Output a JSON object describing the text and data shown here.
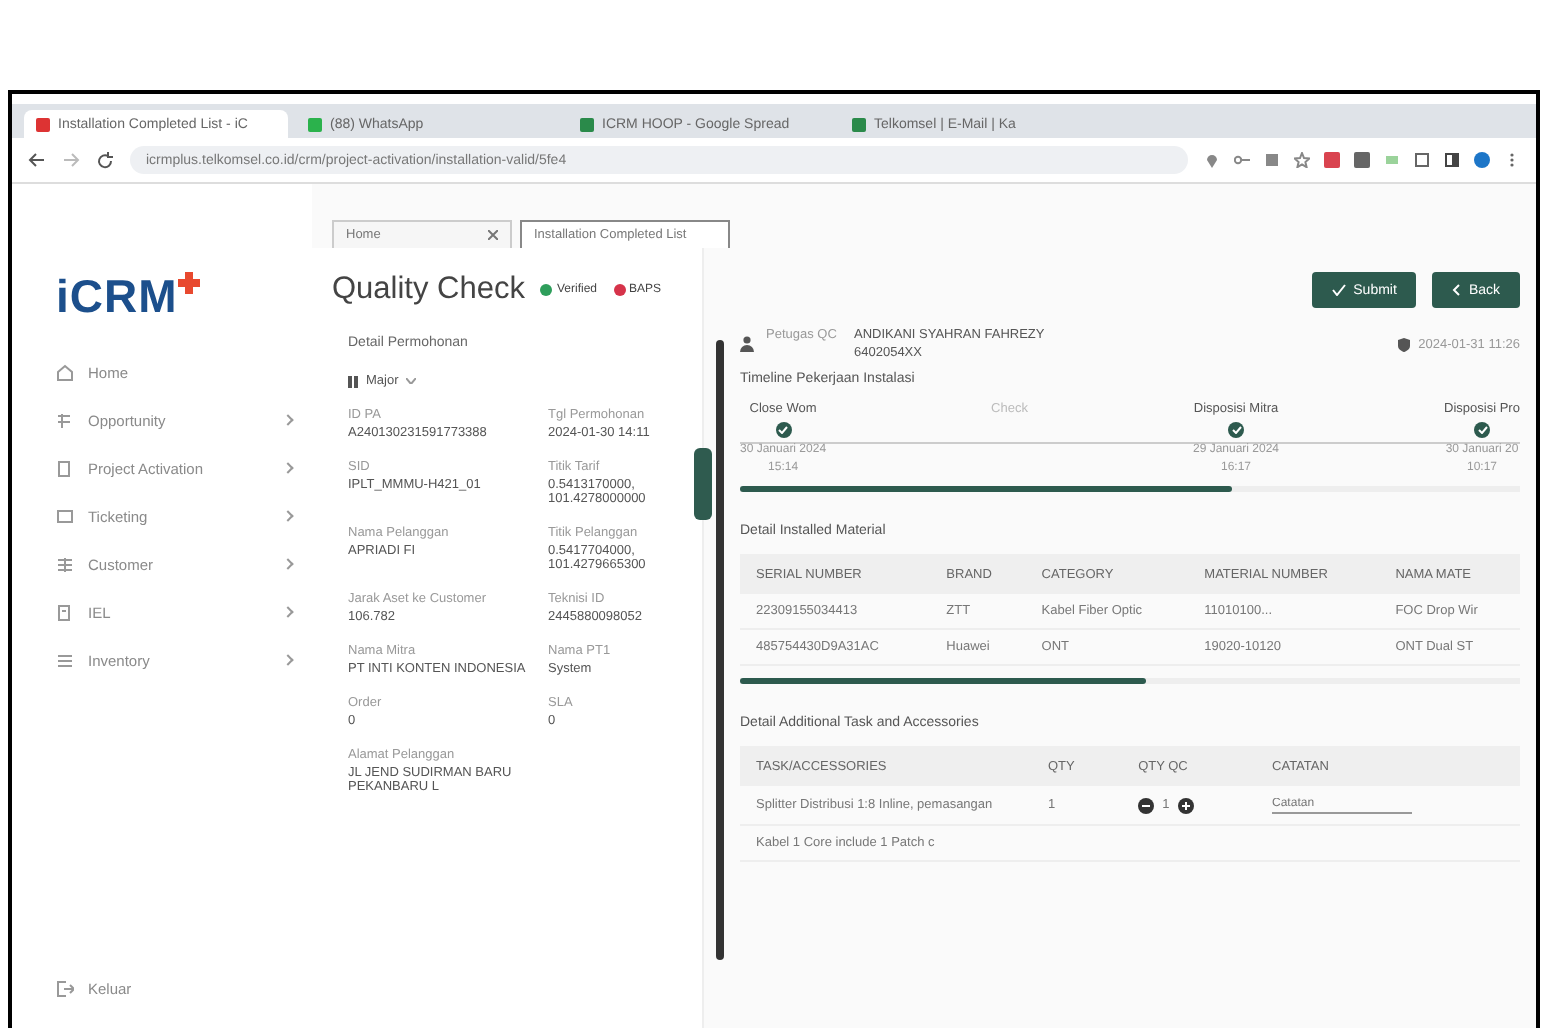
{
  "browser": {
    "tabs": [
      {
        "label": "Installation Completed List - iC",
        "selected": true
      },
      {
        "label": "(88) WhatsApp",
        "selected": false
      },
      {
        "label": "ICRM HOOP - Google Spread",
        "selected": false
      },
      {
        "label": "Telkomsel | E-Mail | Ka",
        "selected": false
      }
    ],
    "url": "icrmplus.telkomsel.co.id/crm/project-activation/installation-valid/5fe4"
  },
  "app_tabs": [
    {
      "label": "Home",
      "selected": false
    },
    {
      "label": "Installation Completed List",
      "selected": true
    }
  ],
  "sidebar": {
    "logo": "iCRM",
    "items": [
      {
        "label": "Home",
        "expandable": false
      },
      {
        "label": "Opportunity",
        "expandable": true
      },
      {
        "label": "Project Activation",
        "expandable": true
      },
      {
        "label": "Ticketing",
        "expandable": true
      },
      {
        "label": "Customer",
        "expandable": true
      },
      {
        "label": "IEL",
        "expandable": true
      },
      {
        "label": "Inventory",
        "expandable": true
      }
    ],
    "logout": "Keluar"
  },
  "page": {
    "title": "Quality Check",
    "badges": [
      {
        "label": "Verified",
        "color": "#2e9e5b"
      },
      {
        "label": "BAPS",
        "color": "#d6334a"
      }
    ]
  },
  "detail": {
    "heading": "Detail Permohonan",
    "priority": "Major",
    "fields": [
      {
        "label": "ID PA",
        "value": "A240130231591773388"
      },
      {
        "label": "Tgl Permohonan",
        "value": "2024-01-30 14:11"
      },
      {
        "label": "SID",
        "value": "IPLT_MMMU-H421_01"
      },
      {
        "label": "Titik Tarif",
        "value": "0.5413170000, 101.4278000000"
      },
      {
        "label": "Nama Pelanggan",
        "value": "APRIADI FI"
      },
      {
        "label": "Titik Pelanggan",
        "value": "0.5417704000, 101.4279665300"
      },
      {
        "label": "Jarak Aset ke Customer",
        "value": "106.782"
      },
      {
        "label": "Teknisi ID",
        "value": "2445880098052"
      },
      {
        "label": "Nama Mitra",
        "value": "PT INTI KONTEN INDONESIA"
      },
      {
        "label": "Nama PT1",
        "value": "System"
      },
      {
        "label": "Order",
        "value": "0"
      },
      {
        "label": "SLA",
        "value": "0"
      },
      {
        "label": "Alamat Pelanggan",
        "value": "JL JEND SUDIRMAN BARU PEKANBARU L"
      }
    ]
  },
  "qc": {
    "submit": "Submit",
    "back": "Back",
    "officer_label": "Petugas QC",
    "officer_name": "ANDIKANI SYAHRAN FAHREZY",
    "officer_id": "6402054XX",
    "timestamp": "2024-01-31 11:26",
    "timeline_title": "Timeline Pekerjaan Instalasi",
    "steps": [
      {
        "kind": "milestone",
        "label": "Close Wom",
        "date": "30 Januari 2024",
        "time": "15:14",
        "done": true
      },
      {
        "kind": "note",
        "label": "Check"
      },
      {
        "kind": "milestone",
        "label": "Disposisi Mitra",
        "date": "29 Januari 2024",
        "time": "16:17",
        "done": true
      },
      {
        "kind": "milestone",
        "label": "Disposisi Pro",
        "date": "30 Januari 20",
        "time": "10:17",
        "done": true
      }
    ]
  },
  "materials": {
    "title": "Detail Installed Material",
    "columns": [
      "SERIAL NUMBER",
      "BRAND",
      "CATEGORY",
      "MATERIAL NUMBER",
      "NAMA MATE"
    ],
    "rows": [
      [
        "22309155034413",
        "ZTT",
        "Kabel Fiber Optic",
        "11010100...",
        "FOC Drop Wir"
      ],
      [
        "485754430D9A31AC",
        "Huawei",
        "ONT",
        "19020-10120",
        "ONT Dual ST"
      ]
    ]
  },
  "additional": {
    "title": "Detail Additional Task and Accessories",
    "columns": [
      "TASK/ACCESSORIES",
      "QTY",
      "QTY QC",
      "CATATAN"
    ],
    "rows": [
      {
        "task": "Splitter Distribusi 1:8 Inline, pemasangan",
        "qty": "1",
        "qty_qc": "1",
        "placeholder": "Catatan"
      },
      {
        "task": "Kabel 1 Core include 1 Patch c",
        "qty": "",
        "qty_qc": "",
        "placeholder": ""
      }
    ]
  }
}
